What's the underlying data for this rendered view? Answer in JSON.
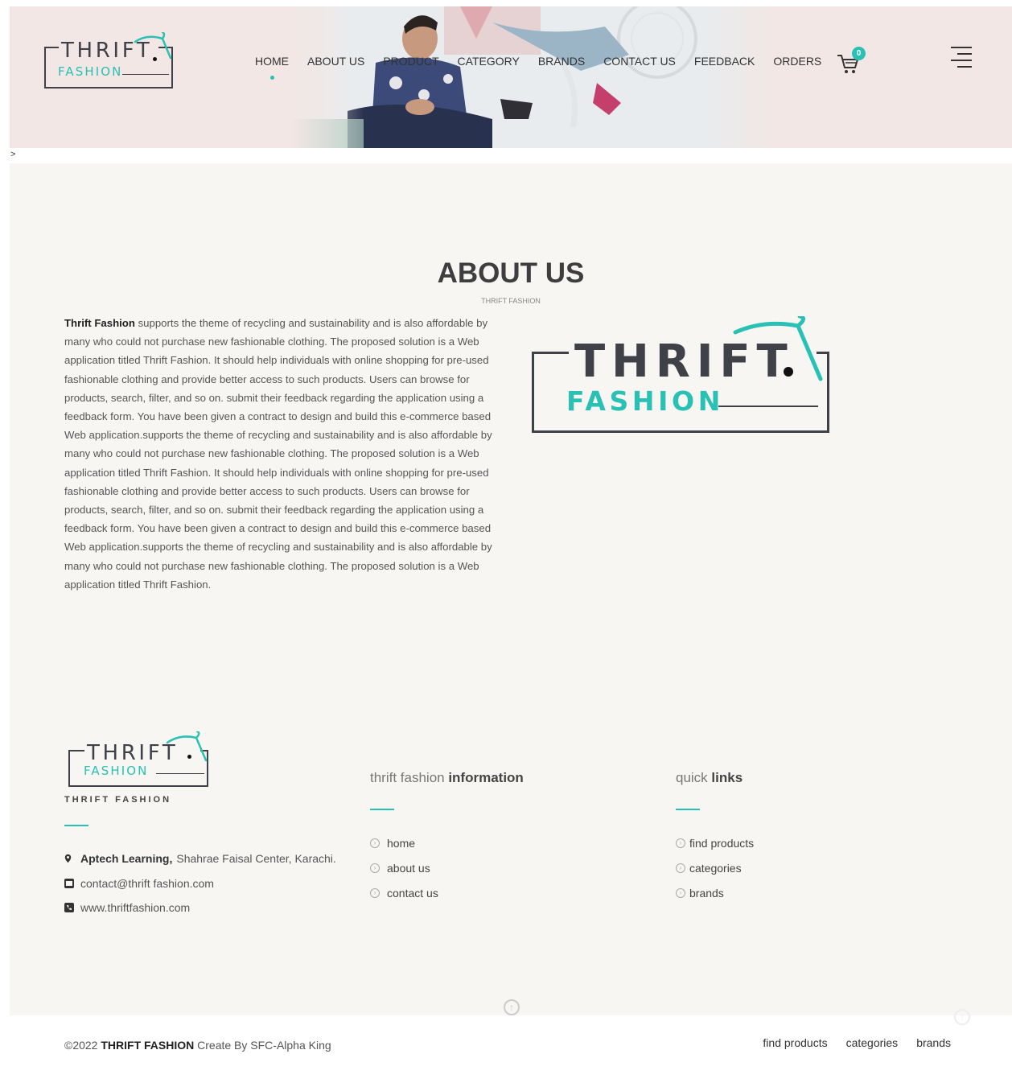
{
  "header": {
    "logo_word1": "THRIFT",
    "logo_word2": "FASHION",
    "nav": [
      "HOME",
      "ABOUT US",
      "PRODUCT",
      "CATEGORY",
      "BRANDS",
      "CONTACT US",
      "FEEDBACK",
      "ORDERS"
    ],
    "cart_count": "0"
  },
  "breadcrumb": ">",
  "about": {
    "title": "ABOUT US",
    "subtitle": "THRIFT FASHION",
    "brand": "Thrift Fashion",
    "body": " supports the theme of recycling and sustainability and is also affordable by many who could not purchase new fashionable clothing. The proposed solution is a Web application titled Thrift Fashion. It should help individuals with online shopping for pre-used fashionable clothing and provide better access to such products. Users can browse for products, search, filter, and so on. submit their feedback regarding the application using a feedback form. You have been given a contract to design and build this e-commerce based Web application.supports the theme of recycling and sustainability and is also affordable by many who could not purchase new fashionable clothing. The proposed solution is a Web application titled Thrift Fashion. It should help individuals with online shopping for pre-used fashionable clothing and provide better access to such products. Users can browse for products, search, filter, and so on. submit their feedback regarding the application using a feedback form. You have been given a contract to design and build this e-commerce based Web application.supports the theme of recycling and sustainability and is also affordable by many who could not purchase new fashionable clothing. The proposed solution is a Web application titled Thrift Fashion."
  },
  "footer": {
    "brand_caption": "THRIFT FASHION",
    "address_bold": "Aptech Learning,",
    "address_rest": "Shahrae Faisal Center, Karachi.",
    "email": "contact@thrift fashion.com",
    "website": "www.thriftfashion.com",
    "info_title_light": "thrift fashion ",
    "info_title_bold": "information",
    "info_links": [
      "home",
      "about us",
      "contact us"
    ],
    "quick_title_light": "quick ",
    "quick_title_bold": "links",
    "quick_links": [
      "find products",
      "categories",
      "brands"
    ]
  },
  "bottom": {
    "copy_prefix": "©2022 ",
    "copy_brand": "THRIFT FASHION",
    "copy_suffix": " Create By SFC-Alpha King",
    "links": [
      "find products",
      "categories",
      "brands"
    ]
  },
  "colors": {
    "accent": "#29c1b3",
    "header_bg": "#f2e7e4",
    "main_bg": "#f7f6f3"
  }
}
